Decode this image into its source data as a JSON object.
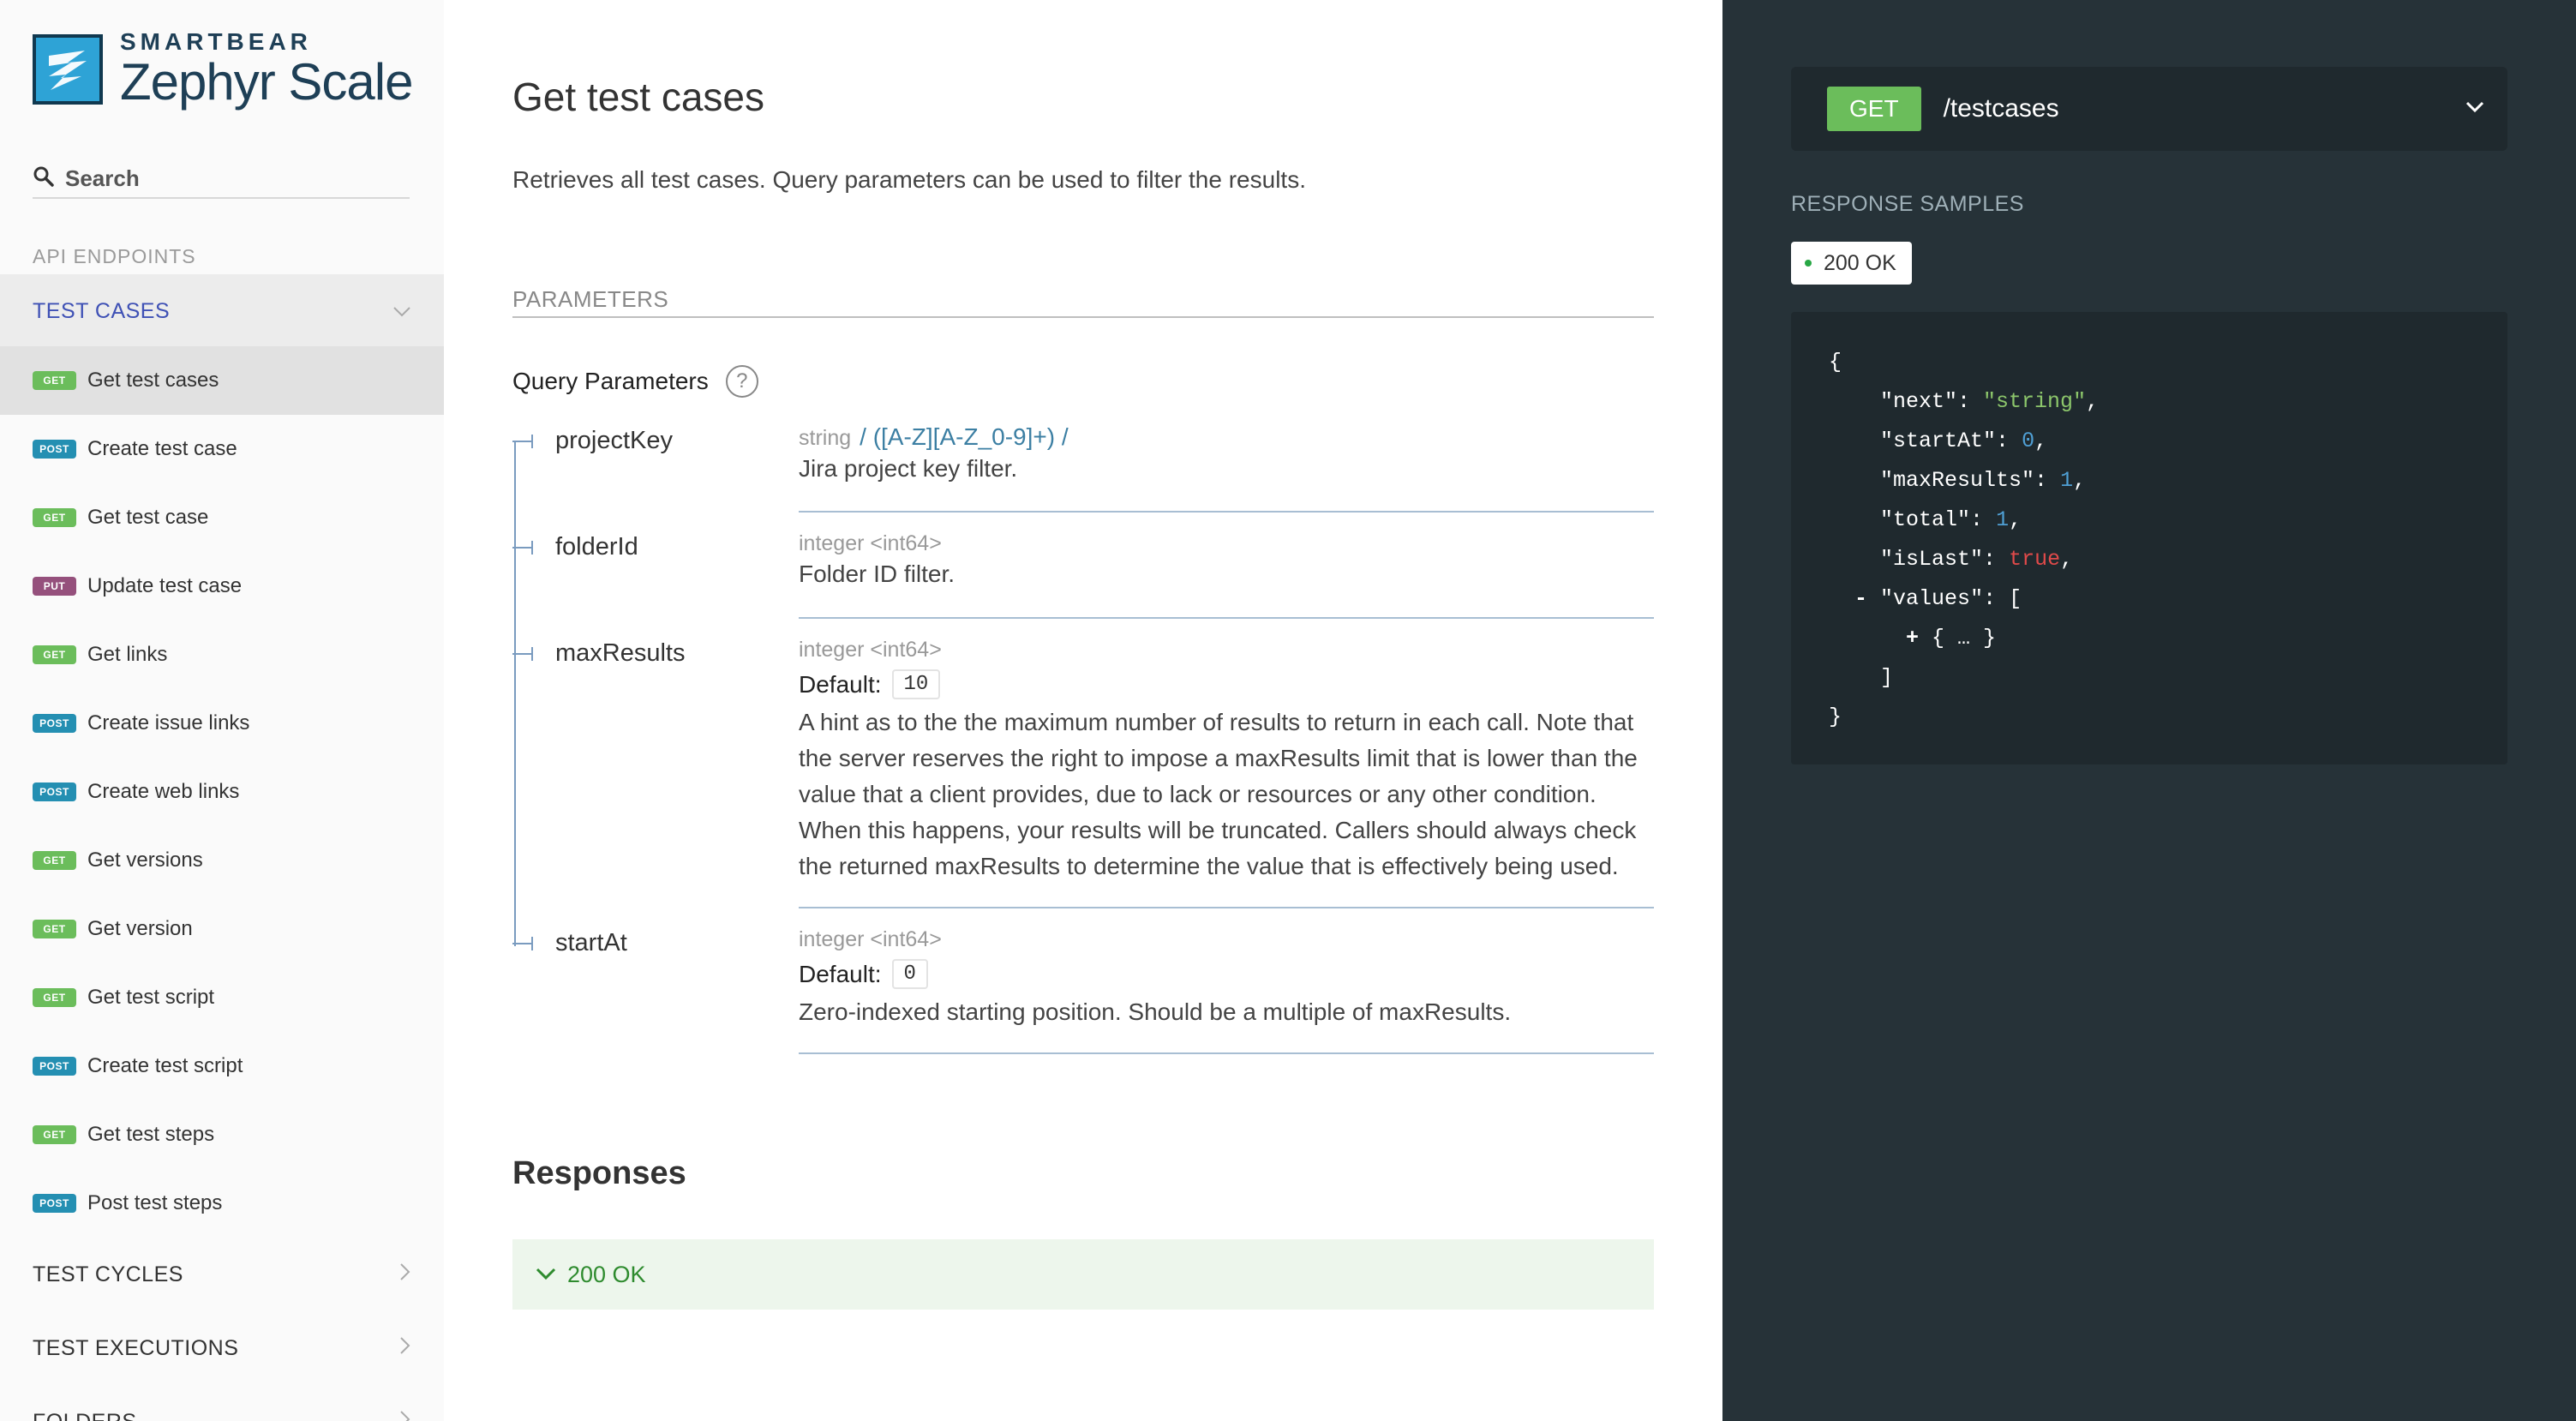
{
  "sidebar": {
    "brand": "SMARTBEAR",
    "product": "Zephyr Scale",
    "search_placeholder": "Search",
    "section_title": "API ENDPOINTS",
    "active_group": "TEST CASES",
    "items": [
      {
        "method": "GET",
        "label": "Get test cases"
      },
      {
        "method": "POST",
        "label": "Create test case"
      },
      {
        "method": "GET",
        "label": "Get test case"
      },
      {
        "method": "PUT",
        "label": "Update test case"
      },
      {
        "method": "GET",
        "label": "Get links"
      },
      {
        "method": "POST",
        "label": "Create issue links"
      },
      {
        "method": "POST",
        "label": "Create web links"
      },
      {
        "method": "GET",
        "label": "Get versions"
      },
      {
        "method": "GET",
        "label": "Get version"
      },
      {
        "method": "GET",
        "label": "Get test script"
      },
      {
        "method": "POST",
        "label": "Create test script"
      },
      {
        "method": "GET",
        "label": "Get test steps"
      },
      {
        "method": "POST",
        "label": "Post test steps"
      }
    ],
    "groups": [
      "TEST CYCLES",
      "TEST EXECUTIONS",
      "FOLDERS"
    ]
  },
  "main": {
    "title": "Get test cases",
    "description": "Retrieves all test cases. Query parameters can be used to filter the results.",
    "parameters_header": "PARAMETERS",
    "query_params_title": "Query Parameters",
    "help_glyph": "?",
    "params": [
      {
        "name": "projectKey",
        "type": "string",
        "pattern": "/ ([A-Z][A-Z_0-9]+) /",
        "description": "Jira project key filter."
      },
      {
        "name": "folderId",
        "type": "integer <int64>",
        "description": "Folder ID filter."
      },
      {
        "name": "maxResults",
        "type": "integer <int64>",
        "default_label": "Default:",
        "default_value": "10",
        "description": "A hint as to the the maximum number of results to return in each call. Note that the server reserves the right to impose a maxResults limit that is lower than the value that a client provides, due to lack or resources or any other condition. When this happens, your results will be truncated. Callers should always check the returned maxResults to determine the value that is effectively being used."
      },
      {
        "name": "startAt",
        "type": "integer <int64>",
        "default_label": "Default:",
        "default_value": "0",
        "description": "Zero-indexed starting position. Should be a multiple of maxResults."
      }
    ],
    "responses_title": "Responses",
    "response_200": "200 OK"
  },
  "right": {
    "method": "GET",
    "path": "/testcases",
    "response_samples": "RESPONSE SAMPLES",
    "status_tab": "200 OK",
    "code": {
      "open": "{",
      "close": "}",
      "next_key": "\"next\"",
      "next_val": "\"string\"",
      "startAt_key": "\"startAt\"",
      "startAt_val": "0",
      "maxResults_key": "\"maxResults\"",
      "maxResults_val": "1",
      "total_key": "\"total\"",
      "total_val": "1",
      "isLast_key": "\"isLast\"",
      "isLast_val": "true",
      "values_key": "\"values\"",
      "collapse_minus": "-",
      "expand_plus": "+",
      "collapsed_obj": "{ … }",
      "arr_open": "[",
      "arr_close": "]"
    }
  },
  "colors": {
    "get": "#6bbd5b",
    "post": "#248fb2",
    "put": "#95507c",
    "accent": "#3f51b5",
    "panel_bg": "#263238"
  }
}
